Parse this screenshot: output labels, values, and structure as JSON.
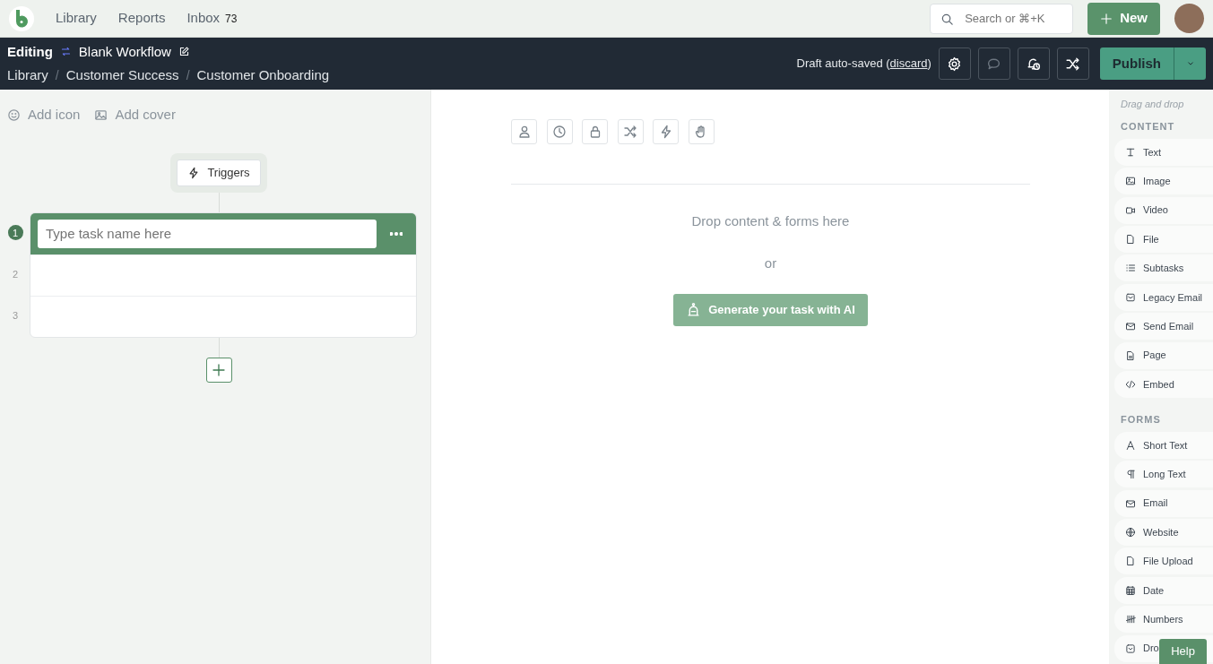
{
  "top_nav": {
    "links": [
      {
        "label": "Library"
      },
      {
        "label": "Reports"
      },
      {
        "label": "Inbox",
        "count": "73"
      }
    ],
    "search": {
      "placeholder": "Search or ⌘+K"
    },
    "new_button": "New"
  },
  "editor_bar": {
    "mode": "Editing",
    "title": "Blank Workflow",
    "breadcrumbs": [
      "Library",
      "Customer Success",
      "Customer Onboarding"
    ],
    "breadcrumb_separator": "/",
    "status": "Draft auto-saved (",
    "discard": "discard",
    "status_end": ")",
    "publish": "Publish"
  },
  "left_panel": {
    "add_icon": "Add icon",
    "add_cover": "Add cover",
    "triggers": "Triggers",
    "tasks": [
      {
        "number": "1",
        "placeholder": "Type task name here",
        "selected": true
      },
      {
        "number": "2",
        "selected": false
      },
      {
        "number": "3",
        "selected": false
      }
    ]
  },
  "canvas": {
    "drop_hint": "Drop content & forms here",
    "or": "or",
    "ai_button": "Generate your task with AI"
  },
  "palette": {
    "hint": "Drag and drop",
    "sections": [
      {
        "title": "CONTENT",
        "items": [
          "Text",
          "Image",
          "Video",
          "File",
          "Subtasks",
          "Legacy Email",
          "Send Email",
          "Page",
          "Embed"
        ]
      },
      {
        "title": "FORMS",
        "items": [
          "Short Text",
          "Long Text",
          "Email",
          "Website",
          "File Upload",
          "Date",
          "Numbers",
          "Dro"
        ]
      }
    ]
  },
  "help_button": "Help"
}
